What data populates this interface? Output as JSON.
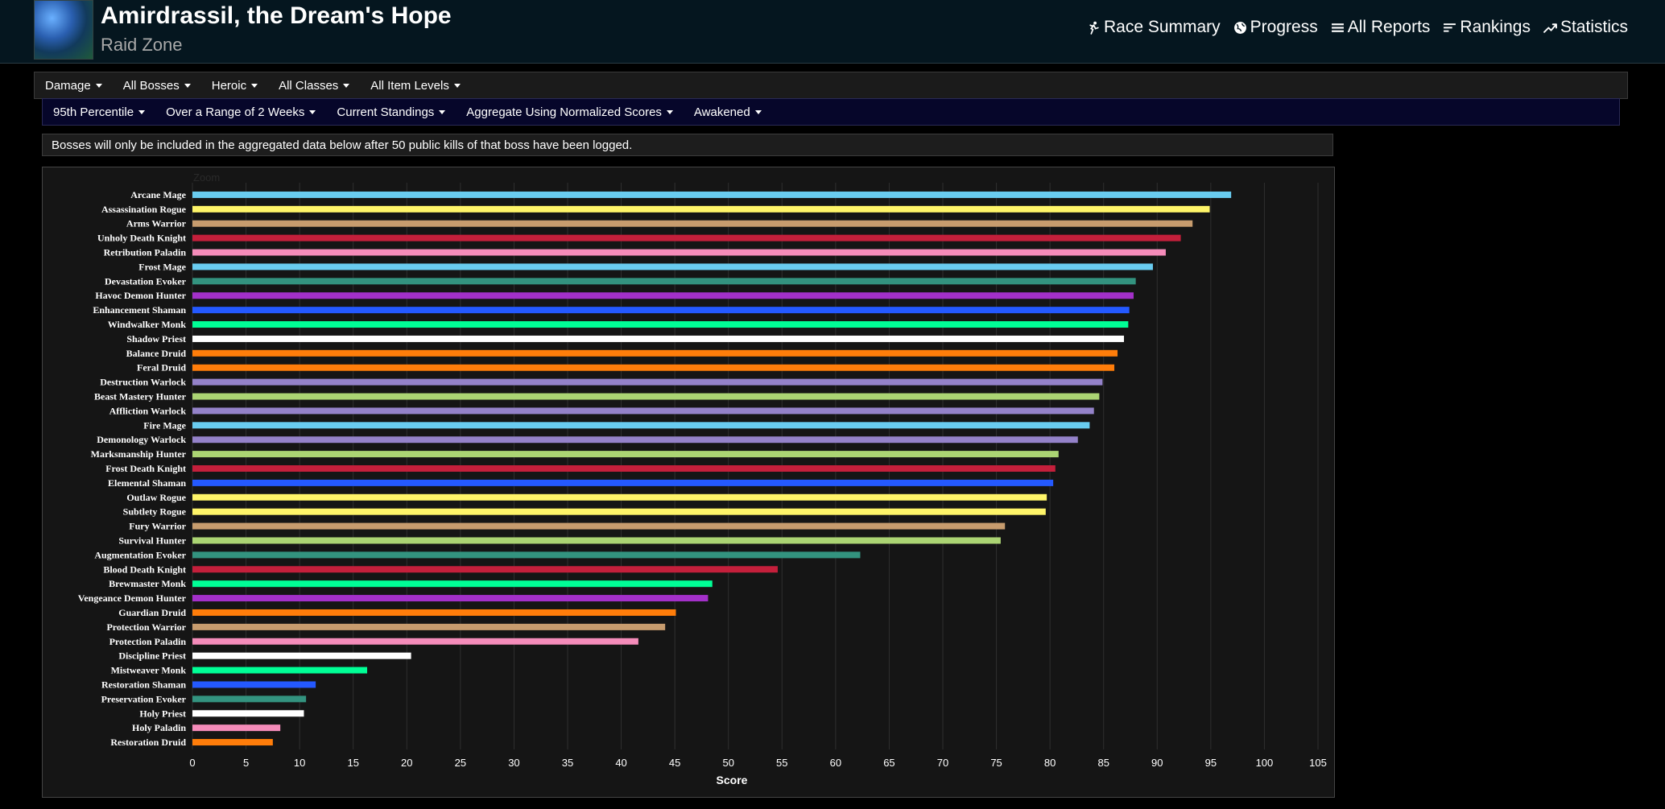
{
  "header": {
    "title": "Amirdrassil, the Dream's Hope",
    "subtitle": "Raid Zone",
    "nav": [
      {
        "label": "Race Summary",
        "icon": "runner-icon"
      },
      {
        "label": "Progress",
        "icon": "globe-icon"
      },
      {
        "label": "All Reports",
        "icon": "list-icon"
      },
      {
        "label": "Rankings",
        "icon": "rankings-icon"
      },
      {
        "label": "Statistics",
        "icon": "trend-icon"
      }
    ]
  },
  "filters_row1": [
    "Damage",
    "All Bosses",
    "Heroic",
    "All Classes",
    "All Item Levels"
  ],
  "filters_row2": [
    "95th Percentile",
    "Over a Range of 2 Weeks",
    "Current Standings",
    "Aggregate Using Normalized Scores",
    "Awakened"
  ],
  "notice": "Bosses will only be included in the aggregated data below after 50 public kills of that boss have been logged.",
  "chart_zoom_label": "Zoom",
  "colors": {
    "mage": "#69ccf0",
    "rogue": "#fff569",
    "warrior": "#c79c6e",
    "death_knight": "#c41f3b",
    "paladin": "#f58cba",
    "evoker": "#33937f",
    "demon_hunter": "#a330c9",
    "shaman": "#0070de",
    "monk": "#00ff96",
    "priest": "#ffffff",
    "druid": "#ff7d0a",
    "warlock": "#9482c9",
    "hunter": "#abd473"
  },
  "chart_data": {
    "type": "bar",
    "orientation": "horizontal",
    "xlabel": "Score",
    "xlim": [
      0,
      105
    ],
    "xticks": [
      0,
      5,
      10,
      15,
      20,
      25,
      30,
      35,
      40,
      45,
      50,
      55,
      60,
      65,
      70,
      75,
      80,
      85,
      90,
      95,
      100,
      105
    ],
    "grid": true,
    "categories": [
      "Arcane Mage",
      "Assassination Rogue",
      "Arms Warrior",
      "Unholy Death Knight",
      "Retribution Paladin",
      "Frost Mage",
      "Devastation Evoker",
      "Havoc Demon Hunter",
      "Enhancement Shaman",
      "Windwalker Monk",
      "Shadow Priest",
      "Balance Druid",
      "Feral Druid",
      "Destruction Warlock",
      "Beast Mastery Hunter",
      "Affliction Warlock",
      "Fire Mage",
      "Demonology Warlock",
      "Marksmanship Hunter",
      "Frost Death Knight",
      "Elemental Shaman",
      "Outlaw Rogue",
      "Subtlety Rogue",
      "Fury Warrior",
      "Survival Hunter",
      "Augmentation Evoker",
      "Blood Death Knight",
      "Brewmaster Monk",
      "Vengeance Demon Hunter",
      "Guardian Druid",
      "Protection Warrior",
      "Protection Paladin",
      "Discipline Priest",
      "Mistweaver Monk",
      "Restoration Shaman",
      "Preservation Evoker",
      "Holy Priest",
      "Holy Paladin",
      "Restoration Druid"
    ],
    "values": [
      96.9,
      94.9,
      93.3,
      92.2,
      90.8,
      89.6,
      88.0,
      87.8,
      87.4,
      87.3,
      86.9,
      86.3,
      86.0,
      84.9,
      84.6,
      84.1,
      83.7,
      82.6,
      80.8,
      80.5,
      80.3,
      79.7,
      79.6,
      75.8,
      75.4,
      62.3,
      54.6,
      48.5,
      48.1,
      45.1,
      44.1,
      41.6,
      20.4,
      16.3,
      11.5,
      10.6,
      10.4,
      8.2,
      7.5
    ],
    "bar_colors": [
      "#69ccf0",
      "#fff569",
      "#c79c6e",
      "#c41f3b",
      "#f58cba",
      "#69ccf0",
      "#33937f",
      "#a330c9",
      "#2459ff",
      "#00ff96",
      "#ffffff",
      "#ff7d0a",
      "#ff7d0a",
      "#9482c9",
      "#abd473",
      "#9482c9",
      "#69ccf0",
      "#9482c9",
      "#abd473",
      "#c41f3b",
      "#2459ff",
      "#fff569",
      "#fff569",
      "#c79c6e",
      "#abd473",
      "#33937f",
      "#c41f3b",
      "#00ff96",
      "#a330c9",
      "#ff7d0a",
      "#c79c6e",
      "#f58cba",
      "#ffffff",
      "#00ff96",
      "#2459ff",
      "#33937f",
      "#ffffff",
      "#f58cba",
      "#ff7d0a"
    ]
  }
}
